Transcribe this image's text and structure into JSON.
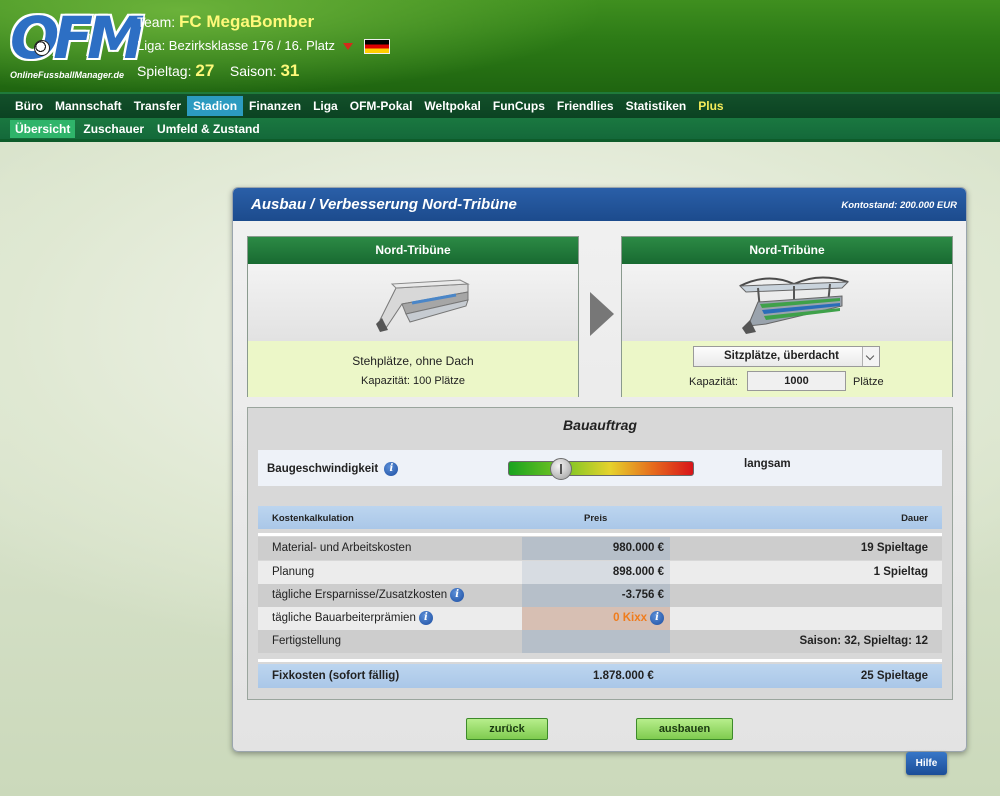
{
  "header": {
    "logo_text": "OnlineFussballManager.de",
    "logo_letters": "OFM",
    "team_label": "Team:",
    "team_name": "FC MegaBomber",
    "liga_text": "Liga: Bezirksklasse 176  /  16. Platz",
    "spieltag_label": "Spieltag:",
    "spieltag_value": "27",
    "saison_label": "Saison:",
    "saison_value": "31"
  },
  "nav": {
    "main": [
      "Büro",
      "Mannschaft",
      "Transfer",
      "Stadion",
      "Finanzen",
      "Liga",
      "OFM-Pokal",
      "Weltpokal",
      "FunCups",
      "Friendlies",
      "Statistiken",
      "Plus"
    ],
    "main_active": "Stadion",
    "sub": [
      "Übersicht",
      "Zuschauer",
      "Umfeld & Zustand"
    ],
    "sub_active": "Übersicht"
  },
  "panel": {
    "title": "Ausbau / Verbesserung Nord-Tribüne",
    "balance": "Kontostand: 200.000 EUR"
  },
  "current_stand": {
    "title": "Nord-Tribüne",
    "type": "Stehplätze, ohne Dach",
    "capacity": "Kapazität: 100 Plätze"
  },
  "new_stand": {
    "title": "Nord-Tribüne",
    "type_selected": "Sitzplätze, überdacht",
    "capacity_label": "Kapazität:",
    "capacity_value": "1000",
    "capacity_unit": "Plätze"
  },
  "bauauftrag": {
    "title": "Bauauftrag",
    "speed_label": "Baugeschwindigkeit",
    "speed_value": "langsam",
    "slider_position": 0.28,
    "cost_header": {
      "label": "Kostenkalkulation",
      "price": "Preis",
      "duration": "Dauer"
    },
    "rows": [
      {
        "label": "Material- und Arbeitskosten",
        "price": "980.000 €",
        "duration": "19 Spieltage",
        "info": false
      },
      {
        "label": "Planung",
        "price": "898.000 €",
        "duration": "1 Spieltag",
        "info": false
      },
      {
        "label": "tägliche Ersparnisse/Zusatzkosten",
        "price": "-3.756 €",
        "duration": "",
        "info": true
      },
      {
        "label": "tägliche Bauarbeiterprämien",
        "price": "0 Kixx",
        "duration": "",
        "info": true
      },
      {
        "label": "Fertigstellung",
        "price": "",
        "duration": "Saison: 32, Spieltag: 12",
        "info": false
      }
    ],
    "total": {
      "label": "Fixkosten (sofort fällig)",
      "price": "1.878.000 €",
      "duration": "25 Spieltage"
    }
  },
  "buttons": {
    "back": "zurück",
    "build": "ausbauen",
    "help": "Hilfe"
  },
  "colors": {
    "header_green": "#2c7a16",
    "nav_dark": "#0b4322",
    "panel_blue": "#1c4b8d",
    "accent_yellow": "#fff97a",
    "orange": "#f07c1c"
  }
}
